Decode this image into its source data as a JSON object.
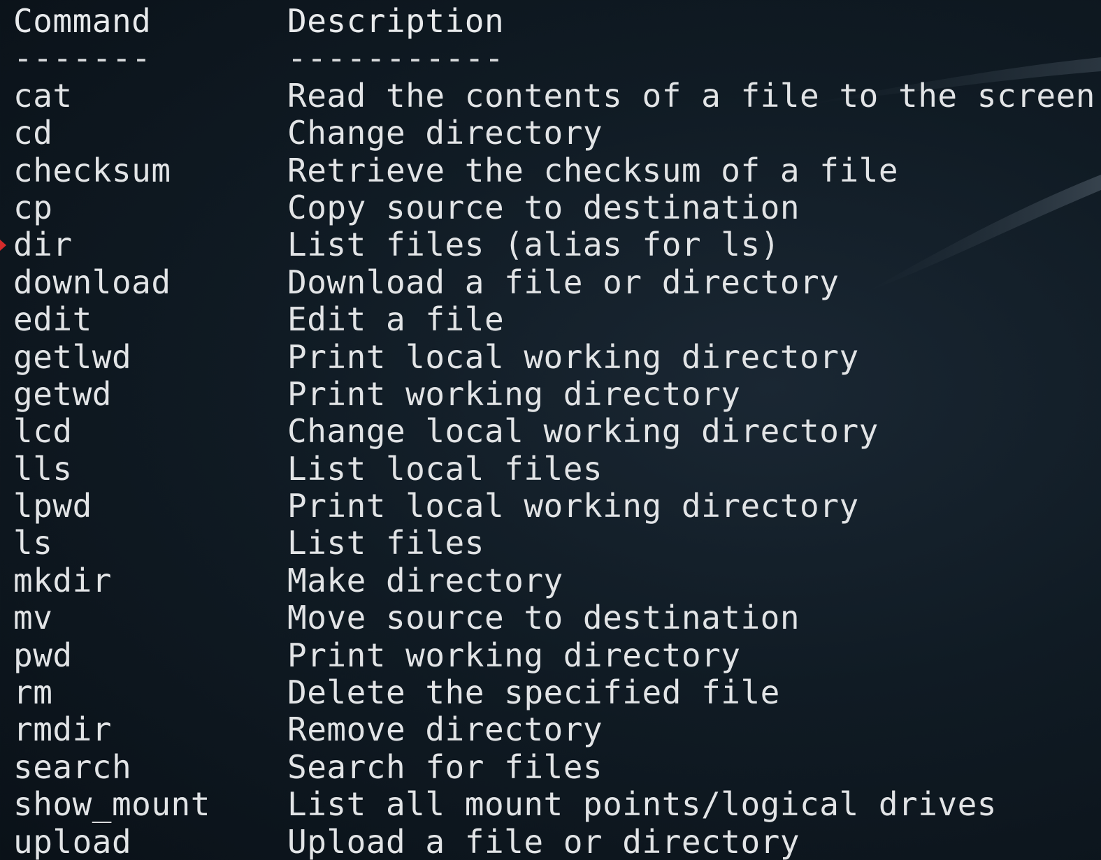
{
  "terminal": {
    "header": {
      "command": "Command",
      "description": "Description"
    },
    "separator": {
      "command": "-------",
      "description": "-----------"
    },
    "rows": [
      {
        "command": "cat",
        "description": "Read the contents of a file to the screen"
      },
      {
        "command": "cd",
        "description": "Change directory"
      },
      {
        "command": "checksum",
        "description": "Retrieve the checksum of a file"
      },
      {
        "command": "cp",
        "description": "Copy source to destination"
      },
      {
        "command": "dir",
        "description": "List files (alias for ls)"
      },
      {
        "command": "download",
        "description": "Download a file or directory"
      },
      {
        "command": "edit",
        "description": "Edit a file"
      },
      {
        "command": "getlwd",
        "description": "Print local working directory"
      },
      {
        "command": "getwd",
        "description": "Print working directory"
      },
      {
        "command": "lcd",
        "description": "Change local working directory"
      },
      {
        "command": "lls",
        "description": "List local files"
      },
      {
        "command": "lpwd",
        "description": "Print local working directory"
      },
      {
        "command": "ls",
        "description": "List files"
      },
      {
        "command": "mkdir",
        "description": "Make directory"
      },
      {
        "command": "mv",
        "description": "Move source to destination"
      },
      {
        "command": "pwd",
        "description": "Print working directory"
      },
      {
        "command": "rm",
        "description": "Delete the specified file"
      },
      {
        "command": "rmdir",
        "description": "Remove directory"
      },
      {
        "command": "search",
        "description": "Search for files"
      },
      {
        "command": "show_mount",
        "description": "List all mount points/logical drives"
      },
      {
        "command": "upload",
        "description": "Upload a file or directory"
      }
    ]
  },
  "colors": {
    "background": "#0b141c",
    "text": "#e2e4e6",
    "marker": "#d62b2b"
  }
}
